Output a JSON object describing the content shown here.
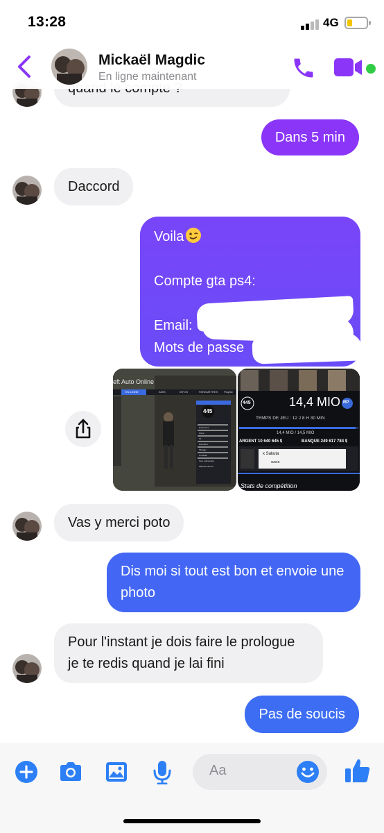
{
  "status_bar": {
    "time": "13:28",
    "network": "4G",
    "battery_level": 0.25
  },
  "header": {
    "contact_name": "Mickaël Magdic",
    "contact_status": "En ligne maintenant"
  },
  "messages": {
    "prev_partial": "quand le compte ?",
    "dans_5_min": "Dans 5 min",
    "daccord": "Daccord",
    "voila_lines": [
      "Voila",
      "",
      "Compte gta ps4:",
      "",
      "Email: ",
      "Mots de passe"
    ],
    "vas_y": "Vas y merci poto",
    "dis_moi": "Dis moi si tout est bon et envoie une photo",
    "pour_linstant": "Pour l'instant je dois faire le prologue je te redis quand je lai fini",
    "pas_de_soucis": "Pas de soucis"
  },
  "photos": {
    "photo1": {
      "header_text": "eft Auto Online",
      "tabs": [
        "EN LIGNE",
        "AMIS",
        "INFOS",
        "PARAMÈTRES",
        "Playlist"
      ],
      "level": "445",
      "stats": [
        "Endurance",
        "Force",
        "Tir",
        "Discrétion",
        "Pilotage",
        "Conduite",
        "Cap. pulmonaire",
        "Maîtrise Mental"
      ]
    },
    "photo2": {
      "level": "445",
      "rp_value": "14,4 MIO",
      "rp_badge": "RP",
      "play_time": "TEMPS DE JEU : 12 J 8 H 30 MIN",
      "rp_progress": "14,4 MIO / 14,5 MIO",
      "money_label": "ARGENT 10 640 645 $",
      "bank_label": "BANQUE 249 617 784 $",
      "crew_name": "x Sakuta",
      "crew_tag": "SAKX",
      "footer": "Stats de compétition"
    }
  },
  "composer": {
    "placeholder": "Aa"
  },
  "colors": {
    "accent": "#8a35f8",
    "bubble_violet": "#7845f8",
    "bubble_blue": "#4367f4",
    "incoming": "#f0f0f2",
    "online": "#31cc46",
    "icon_blue": "#2d7ff5"
  }
}
